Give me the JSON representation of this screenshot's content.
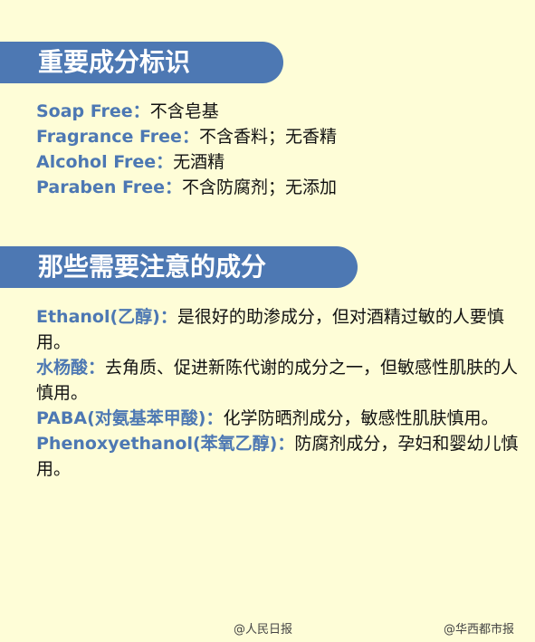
{
  "section1": {
    "title": "重要成分标识",
    "items": [
      {
        "term": "Soap Free：",
        "desc": "不含皂基"
      },
      {
        "term": "Fragrance Free：",
        "desc": "不含香料；无香精"
      },
      {
        "term": "Alcohol Free：",
        "desc": "无酒精"
      },
      {
        "term": "Paraben Free：",
        "desc": "不含防腐剂；无添加"
      }
    ]
  },
  "section2": {
    "title": "那些需要注意的成分",
    "items": [
      {
        "term": "Ethanol(乙醇)：",
        "desc": "是很好的助渗成分，但对酒精过敏的人要慎用。"
      },
      {
        "term": "水杨酸：",
        "desc": "去角质、促进新陈代谢的成分之一，但敏感性肌肤的人慎用。"
      },
      {
        "term": "PABA(对氨基苯甲酸)：",
        "desc": "化学防晒剂成分，敏感性肌肤慎用。"
      },
      {
        "term": "Phenoxyethanol(苯氧乙醇)：",
        "desc": "防腐剂成分，孕妇和婴幼儿慎用。"
      }
    ]
  },
  "watermarks": {
    "left": "@人民日报",
    "right": "@华西都市报"
  },
  "colors": {
    "background": "#fefdd7",
    "accent": "#4d78b3",
    "text": "#111111"
  }
}
